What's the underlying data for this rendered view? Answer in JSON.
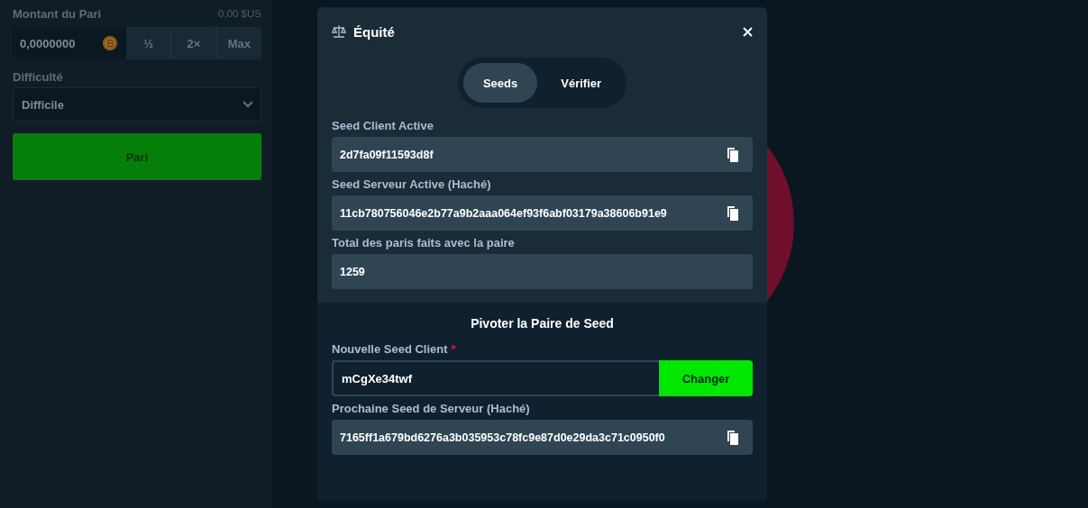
{
  "bet_panel": {
    "amount_label": "Montant du Pari",
    "amount_usd": "0,00 $US",
    "amount_value": "0,0000000",
    "quick_buttons": [
      "½",
      "2×",
      "Max"
    ],
    "difficulty_label": "Difficulté",
    "difficulty_value": "Difficile",
    "bet_button": "Pari"
  },
  "modal": {
    "title": "Équité",
    "tabs": [
      {
        "label": "Seeds",
        "selected": true
      },
      {
        "label": "Vérifier",
        "selected": false
      }
    ],
    "fields": [
      {
        "label": "Seed Client Active",
        "value": "2d7fa09f11593d8f",
        "copyable": true
      },
      {
        "label": "Seed Serveur Active (Haché)",
        "value": "11cb780756046e2b77a9b2aaa064ef93f6abf03179a38606b91e9",
        "copyable": true
      },
      {
        "label": "Total des paris faits avec la paire",
        "value": "1259",
        "copyable": false
      }
    ],
    "rotate_section": {
      "title": "Pivoter la Paire de Seed",
      "new_seed_label": "Nouvelle Seed Client",
      "required_mark": "*",
      "new_seed_value": "mCgXe34twf",
      "change_button": "Changer",
      "next_seed": {
        "label": "Prochaine Seed de Serveur (Haché)",
        "value": "7165ff1a679bd6276a3b035953c78fc9e87d0e29da3c71c0950f0",
        "copyable": true
      }
    }
  }
}
